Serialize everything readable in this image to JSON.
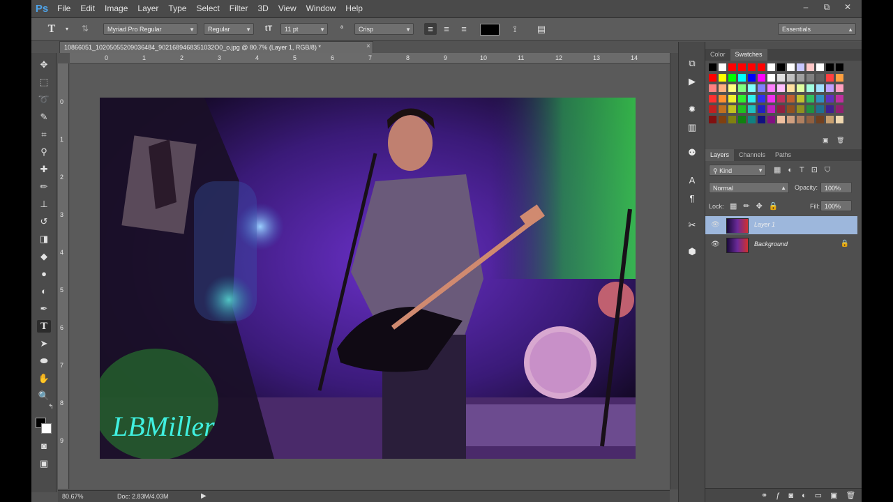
{
  "app": {
    "logo": "Ps"
  },
  "menu": [
    "File",
    "Edit",
    "Image",
    "Layer",
    "Type",
    "Select",
    "Filter",
    "3D",
    "View",
    "Window",
    "Help"
  ],
  "window_controls": [
    "–",
    "⧉",
    "✕"
  ],
  "options_bar": {
    "tool_glyph": "T",
    "font_family": "Myriad Pro Regular",
    "font_style": "Regular",
    "font_size": "11 pt",
    "antialias_label": "ª",
    "antialias": "Crisp",
    "text_color": "#000000",
    "workspace": "Essentials"
  },
  "document_tab": {
    "title": "10866051_10205055209036484_9021689468351032O0_o.jpg @ 80.7% (Layer 1, RGB/8) *",
    "close": "×"
  },
  "rulers": {
    "top": [
      "0",
      "1",
      "2",
      "3",
      "4",
      "5",
      "6",
      "7",
      "8",
      "9",
      "10",
      "11",
      "12",
      "13",
      "14"
    ],
    "left": [
      "0",
      "1",
      "2",
      "3",
      "4",
      "5",
      "6",
      "7",
      "8",
      "9"
    ]
  },
  "status": {
    "zoom": "80.67%",
    "doc": "Doc: 2.83M/4.03M"
  },
  "panels": {
    "top_tabs": [
      "Color",
      "Swatches"
    ],
    "active_top_tab": "Swatches",
    "layers_tabs": [
      "Layers",
      "Channels",
      "Paths"
    ],
    "active_layers_tab": "Layers",
    "filter_kind": "Kind",
    "blend_mode": "Normal",
    "opacity_label": "Opacity:",
    "opacity": "100%",
    "lock_label": "Lock:",
    "fill_label": "Fill:",
    "fill": "100%",
    "layers": [
      {
        "name": "Layer 1",
        "selected": true,
        "locked": false
      },
      {
        "name": "Background",
        "selected": false,
        "locked": true
      }
    ]
  },
  "photo": {
    "signature": "LBMiller",
    "colors": {
      "stage_purple": "#5a2aa0",
      "green_light": "#2ec24a",
      "drum_pink": "#d08ac0"
    }
  },
  "swatch_colors": [
    [
      "#000000",
      "#ffffff",
      "#ff0000",
      "#ff0000",
      "#ff0000",
      "#ff0000",
      "#ffffff",
      "#000000",
      "#ffffff",
      "#c8c8ff",
      "#ffc8c8",
      "#ffffff",
      "#000000",
      "#000000"
    ],
    [
      "#ff0000",
      "#ffff00",
      "#00ff00",
      "#00ffff",
      "#0000ff",
      "#ff00ff",
      "#ffffff",
      "#e0e0e0",
      "#c0c0c0",
      "#a0a0a0",
      "#808080",
      "#606060",
      "#ff4040",
      "#ffa040"
    ],
    [
      "#ff8080",
      "#ffb080",
      "#ffff80",
      "#80ff80",
      "#80ffff",
      "#8080ff",
      "#ff80ff",
      "#ffc0ff",
      "#ffe0a0",
      "#e0ffa0",
      "#a0ffe0",
      "#a0e0ff",
      "#c0a0ff",
      "#ffa0c0"
    ],
    [
      "#ff3030",
      "#ff9030",
      "#f0f030",
      "#30f030",
      "#30f0f0",
      "#3030f0",
      "#f030f0",
      "#c03060",
      "#c06030",
      "#c0c030",
      "#30c060",
      "#3090c0",
      "#6030c0",
      "#c030a0"
    ],
    [
      "#c02020",
      "#c07020",
      "#c0c020",
      "#20c020",
      "#20c0c0",
      "#2020c0",
      "#c020c0",
      "#902040",
      "#905020",
      "#909020",
      "#209040",
      "#207090",
      "#402090",
      "#902070"
    ],
    [
      "#801010",
      "#804010",
      "#808010",
      "#108010",
      "#108080",
      "#101080",
      "#801080",
      "#f0c0a0",
      "#d0a080",
      "#b08060",
      "#906040",
      "#704020",
      "#c8a070",
      "#f0d8b0"
    ]
  ]
}
